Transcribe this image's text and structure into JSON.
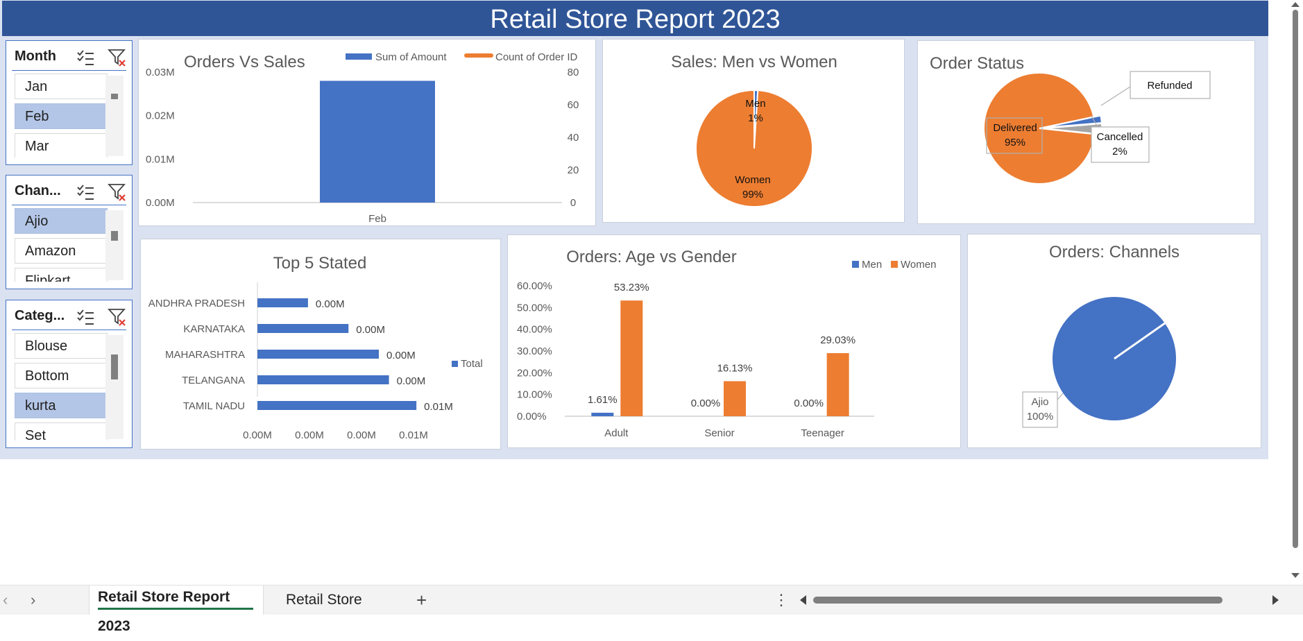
{
  "title": "Retail Store Report 2023",
  "colors": {
    "blue": "#4472c4",
    "orange": "#ed7d31",
    "gray": "#a5a5a5",
    "banner": "#2f5597",
    "selected": "#b4c6e7"
  },
  "slicers": [
    {
      "title": "Month",
      "items": [
        {
          "label": "Jan",
          "selected": false
        },
        {
          "label": "Feb",
          "selected": true
        },
        {
          "label": "Mar",
          "selected": false
        }
      ]
    },
    {
      "title": "Chan...",
      "items": [
        {
          "label": "Ajio",
          "selected": true
        },
        {
          "label": "Amazon",
          "selected": false
        },
        {
          "label": "Flipkart",
          "selected": false
        }
      ]
    },
    {
      "title": "Categ...",
      "items": [
        {
          "label": "Blouse",
          "selected": false
        },
        {
          "label": "Bottom",
          "selected": false
        },
        {
          "label": "kurta",
          "selected": true
        },
        {
          "label": "Set",
          "selected": false
        }
      ]
    }
  ],
  "slicer_icons": [
    "multi-select-icon",
    "clear-filter-icon"
  ],
  "chart_data": [
    {
      "type": "bar",
      "title": "Orders Vs Sales",
      "categories": [
        "Feb"
      ],
      "series": [
        {
          "name": "Sum of Amount",
          "values": [
            0.028
          ]
        },
        {
          "name": "Count of Order ID",
          "values": [
            0
          ]
        }
      ],
      "y_ticks": [
        "0.00M",
        "0.01M",
        "0.02M",
        "0.03M"
      ],
      "y2_ticks": [
        "0",
        "20",
        "40",
        "60",
        "80"
      ],
      "ylim": [
        0,
        0.03
      ],
      "legend": "top"
    },
    {
      "type": "pie",
      "title": "Sales: Men vs Women",
      "labels": [
        "Men",
        "Women"
      ],
      "values": [
        1,
        99
      ],
      "data_labels": [
        "1%",
        "99%"
      ]
    },
    {
      "type": "pie",
      "title": "Order Status",
      "labels": [
        "Delivered",
        "Cancelled",
        "Refunded"
      ],
      "values": [
        95,
        2,
        3
      ],
      "data_labels": [
        "95%",
        "2%",
        ""
      ]
    },
    {
      "type": "bar",
      "title": "Top 5 Stated",
      "orientation": "horizontal",
      "categories": [
        "ANDHRA PRADESH",
        "KARNATAKA",
        "MAHARASHTRA",
        "TELANGANA",
        "TAMIL NADU"
      ],
      "series": [
        {
          "name": "Total",
          "values": [
            0.0035,
            0.0063,
            0.0084,
            0.0091,
            0.011
          ]
        }
      ],
      "data_labels": [
        "0.00M",
        "0.00M",
        "0.00M",
        "0.00M",
        "0.01M"
      ],
      "x_ticks": [
        "0.00M",
        "0.00M",
        "0.00M",
        "0.01M"
      ],
      "legend": "right"
    },
    {
      "type": "bar",
      "title": "Orders: Age vs Gender",
      "categories": [
        "Adult",
        "Senior",
        "Teenager"
      ],
      "series": [
        {
          "name": "Men",
          "values": [
            1.61,
            0,
            0
          ]
        },
        {
          "name": "Women",
          "values": [
            53.23,
            16.13,
            29.03
          ]
        }
      ],
      "data_labels": [
        [
          "1.61%",
          "0.00%",
          "0.00%"
        ],
        [
          "53.23%",
          "16.13%",
          "29.03%"
        ]
      ],
      "y_ticks": [
        "0.00%",
        "10.00%",
        "20.00%",
        "30.00%",
        "40.00%",
        "50.00%",
        "60.00%"
      ],
      "ylim": [
        0,
        60
      ],
      "legend": "top-right"
    },
    {
      "type": "pie",
      "title": "Orders: Channels",
      "labels": [
        "Ajio"
      ],
      "values": [
        100
      ],
      "data_labels": [
        "100%"
      ]
    }
  ],
  "sheet_tabs": [
    {
      "label": "Retail Store Report 2023",
      "active": true
    },
    {
      "label": "Retail Store",
      "active": false
    }
  ],
  "sheet_icons": [
    "prev-sheet-icon",
    "next-sheet-icon",
    "add-sheet-icon",
    "more-options-icon"
  ]
}
